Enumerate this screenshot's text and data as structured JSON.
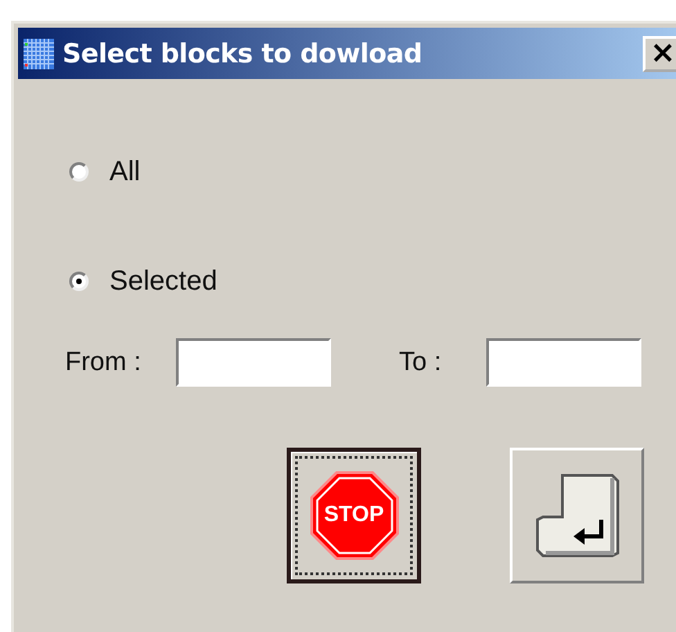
{
  "window": {
    "title": "Select blocks to dowload",
    "close_label": "×"
  },
  "options": [
    {
      "label": "All",
      "selected": false
    },
    {
      "label": "Selected",
      "selected": true
    }
  ],
  "fields": [
    {
      "label": "From :"
    },
    {
      "label": "To :"
    }
  ],
  "buttons": [
    {
      "kind": "stop",
      "text": "STOP",
      "focused": true
    },
    {
      "kind": "enter",
      "focused": false
    }
  ]
}
